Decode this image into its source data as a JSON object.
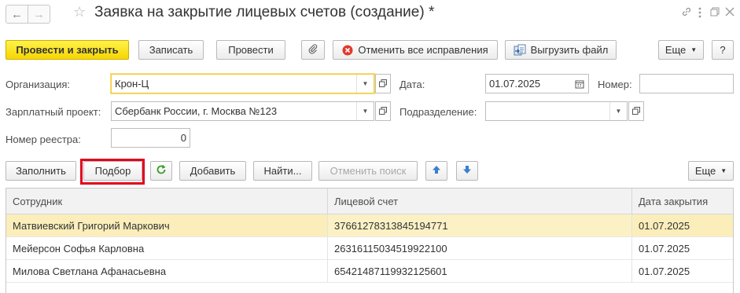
{
  "window": {
    "title": "Заявка на закрытие лицевых счетов (создание) *"
  },
  "toolbar": {
    "post_and_close": "Провести и закрыть",
    "save": "Записать",
    "post": "Провести",
    "cancel_corrections": "Отменить все исправления",
    "export_file": "Выгрузить файл",
    "more": "Еще",
    "help": "?"
  },
  "form": {
    "organization_label": "Организация:",
    "organization_value": "Крон-Ц",
    "date_label": "Дата:",
    "date_value": "01.07.2025",
    "number_label": "Номер:",
    "number_value": "",
    "salary_project_label": "Зарплатный проект:",
    "salary_project_value": "Сбербанк России, г. Москва №123",
    "department_label": "Подразделение:",
    "department_value": "",
    "registry_number_label": "Номер реестра:",
    "registry_number_value": "0"
  },
  "table_toolbar": {
    "fill": "Заполнить",
    "pick": "Подбор",
    "add": "Добавить",
    "find": "Найти...",
    "cancel_search": "Отменить поиск",
    "more": "Еще"
  },
  "table": {
    "columns": [
      "Сотрудник",
      "Лицевой счет",
      "Дата закрытия"
    ],
    "rows": [
      {
        "employee": "Матвиевский Григорий Маркович",
        "account": "37661278313845194771",
        "date": "01.07.2025"
      },
      {
        "employee": "Мейерсон Софья Карловна",
        "account": "26316115034519922100",
        "date": "01.07.2025"
      },
      {
        "employee": "Милова Светлана Афанасьевна",
        "account": "65421487119932125601",
        "date": "01.07.2025"
      }
    ]
  },
  "colors": {
    "primary_button": "#f6d601",
    "selected_row": "#fbeebb",
    "highlight_frame": "#e3001b",
    "focused_field": "#f2cb3c"
  },
  "icons": {
    "back": "arrow-left-icon",
    "forward": "arrow-right-icon",
    "favorite": "star-icon",
    "link": "link-icon",
    "menu": "kebab-menu-icon",
    "restore": "restore-window-icon",
    "close": "close-icon",
    "attach": "paperclip-icon",
    "cancel": "red-x-circle-icon",
    "export": "export-file-icon",
    "calendar": "calendar-icon",
    "refresh": "refresh-icon",
    "move_up": "arrow-up-icon",
    "move_down": "arrow-down-icon"
  }
}
